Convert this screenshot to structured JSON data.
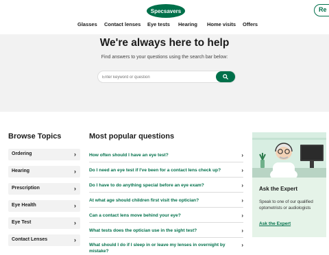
{
  "header": {
    "logo_text": "Specsavers",
    "right_button": "Re",
    "nav": [
      "Glasses",
      "Contact lenses",
      "Eye tests",
      "Hearing",
      "Home visits",
      "Offers"
    ]
  },
  "hero": {
    "title": "We're always here to help",
    "subtitle": "Find answers to your questions using the search bar below:",
    "search_placeholder": "Enter keyword or question"
  },
  "browse": {
    "title": "Browse Topics",
    "topics": [
      "Ordering",
      "Hearing",
      "Prescription",
      "Eye Health",
      "Eye Test",
      "Contact Lenses"
    ]
  },
  "popular": {
    "title": "Most popular questions",
    "questions": [
      "How often should I have an eye test?",
      "Do I need an eye test if I've been for a contact lens check up?",
      "Do I have to do anything special before an eye exam?",
      "At what age should children first visit the optician?",
      "Can a contact lens move behind your eye?",
      "What tests does the optician use in the sight test?",
      "What should I do if I sleep in or leave my lenses in overnight by mistake?"
    ]
  },
  "expert": {
    "title": "Ask the Expert",
    "text": "Speak to one of our qualified optometrists or audiologists",
    "link": "Ask the Expert"
  },
  "colors": {
    "brand": "#00704a",
    "hero_bg": "#f2f2f2",
    "expert_bg": "#e5f3e8"
  },
  "icons": {
    "search": "search-icon",
    "chevron": "chevron-right-icon"
  }
}
